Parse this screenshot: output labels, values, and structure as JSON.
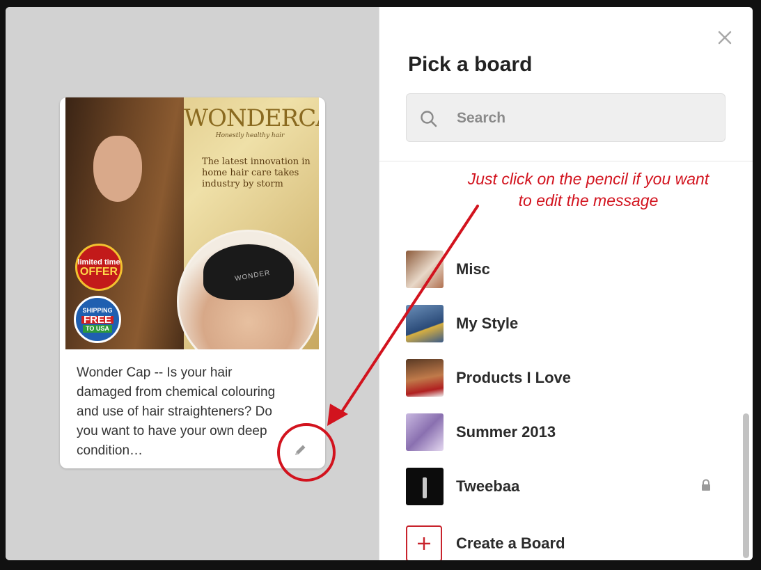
{
  "dialog": {
    "title": "Pick a board",
    "search": {
      "placeholder": "Search",
      "value": ""
    },
    "close_icon": "close-icon"
  },
  "pin": {
    "image": {
      "brand": "WONDERCAP",
      "brand_tagline": "Honestly healthy hair",
      "promo_text": "The latest innovation in home hair care takes industry by storm",
      "cap_label": "WONDER",
      "badge_offer_top": "limited time",
      "badge_offer_main": "OFFER",
      "badge_free_top": "SHIPPING",
      "badge_free_main": "FREE",
      "badge_free_bottom": "TO USA"
    },
    "description": "Wonder Cap -- Is your hair damaged from chemical colouring and use of hair straighteners? Do you want to have your own deep condition…",
    "edit_icon": "pencil-icon"
  },
  "boards": [
    {
      "name": "Misc",
      "secret": false
    },
    {
      "name": "My Style",
      "secret": false
    },
    {
      "name": "Products I Love",
      "secret": false
    },
    {
      "name": "Summer 2013",
      "secret": false
    },
    {
      "name": "Tweebaa",
      "secret": true
    }
  ],
  "create_board_label": "Create a Board",
  "annotation": {
    "text": "Just click on the pencil if you want to edit the message",
    "color": "#d2131e"
  },
  "colors": {
    "accent": "#c8232c",
    "overlay_gray": "#d2d2d2"
  }
}
